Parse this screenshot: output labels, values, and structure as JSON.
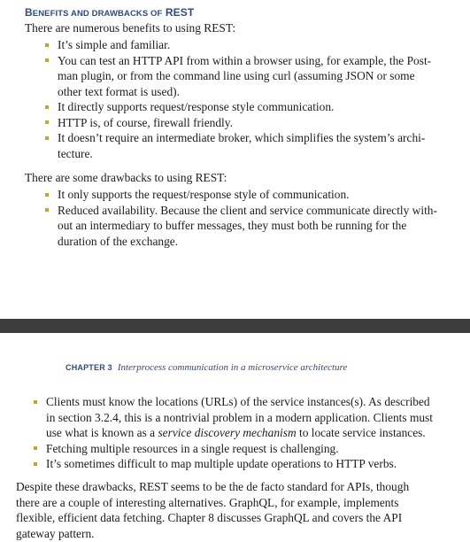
{
  "top_page": {
    "sidebar_heading": {
      "part1_big": "B",
      "part1_small": "ENEFITS AND DRAWBACKS OF",
      "part2": "REST"
    },
    "benefits_intro": "There are numerous benefits to using REST:",
    "benefits": [
      {
        "lines": [
          "It’s simple and familiar."
        ]
      },
      {
        "lines": [
          "You can test an HTTP API from within a browser using, for example, the Post-",
          "man plugin, or from the command line using curl (assuming JSON or some",
          "other text format is used)."
        ]
      },
      {
        "lines": [
          "It directly supports request/response style communication."
        ]
      },
      {
        "lines": [
          "HTTP is, of course, firewall friendly."
        ]
      },
      {
        "lines": [
          "It doesn’t require an intermediate broker, which simplifies the system’s archi-",
          "tecture."
        ]
      }
    ],
    "drawbacks_intro": "There are some drawbacks to using REST:",
    "drawbacks": [
      {
        "lines": [
          "It only supports the request/response style of communication."
        ]
      },
      {
        "lines": [
          "Reduced availability. Because the client and service communicate directly with-",
          "out an intermediary to buffer messages, they must both be running for the",
          "duration of the exchange."
        ]
      }
    ]
  },
  "bottom_page": {
    "chapter_label": "CHAPTER 3",
    "chapter_title": "Interprocess communication in a microservice architecture",
    "bullets": [
      {
        "lines": [
          "Clients must know the locations (URLs) of the service instances(s). As described",
          "in section 3.2.4, this is a nontrivial problem in a modern application. Clients must"
        ],
        "line3_pre": "use what is known as a ",
        "line3_em": "service discovery mechanism",
        "line3_post": " to locate service instances."
      },
      {
        "lines": [
          "Fetching multiple resources in a single request is challenging."
        ]
      },
      {
        "lines": [
          "It’s sometimes difficult to map multiple update operations to HTTP verbs."
        ]
      }
    ],
    "closing_paragraph": [
      "Despite these drawbacks, REST seems to be the de facto standard for APIs, though",
      "there are a couple of interesting alternatives. GraphQL, for example, implements",
      "flexible, efficient data fetching. Chapter 8 discusses GraphQL and covers the API",
      "gateway pattern."
    ]
  }
}
